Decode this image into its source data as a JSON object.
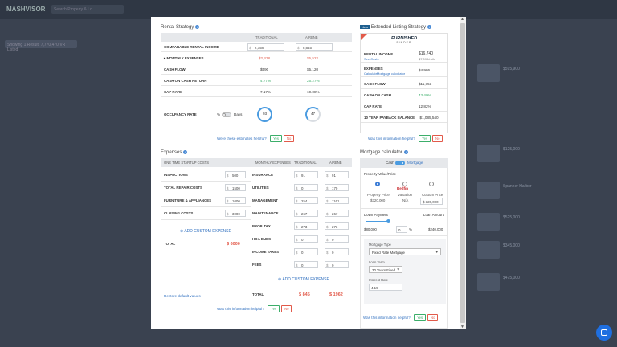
{
  "background": {
    "logo": "MASHVISOR",
    "search_placeholder": "Search Property & Lo",
    "chip": "Showing 1 Result, 7,770,470 VR Listed",
    "listing_title_1": "$595,900",
    "listing_title_2": "$125,000",
    "listing_title_3": "$525,000",
    "listing_title_4": "$345,000",
    "listing_title_5": "$475,000",
    "listing_sub": "Spanner Harbor"
  },
  "rental_strategy": {
    "title": "Rental Strategy",
    "col_traditional": "TRADITIONAL",
    "col_airbnb": "AIRBNB",
    "comparable_label": "COMPARABLE RENTAL INCOME",
    "comparable_trad": "2,758",
    "comparable_air": "8,645",
    "currency": "$",
    "monthly_expenses_label": "MONTHLY EXPENSES",
    "monthly_expenses_trad": "$2,438",
    "monthly_expenses_air": "$5,522",
    "cash_flow_label": "CASH FLOW",
    "cash_flow_trad": "$590",
    "cash_flow_air": "$5,120",
    "coc_label": "CASH ON CASH RETURN",
    "coc_trad": "4.77%",
    "coc_air": "25.27%",
    "cap_label": "CAP RATE",
    "cap_trad": "7.17%",
    "cap_air": "10.08%",
    "occupancy_label": "OCCUPANCY RATE",
    "occupancy_pct": "%",
    "occupancy_days": "Days",
    "occupancy_trad": "93",
    "occupancy_air": "47",
    "helpful": "Were these estimates helpful?",
    "yes": "Yes",
    "no": "No"
  },
  "extended": {
    "badge": "New",
    "title": "Extended Listing Strategy",
    "brand_line1": "FURNISHED",
    "brand_line2": "FINDER",
    "rental_income_label": "RENTAL INCOME",
    "rental_income_link": "See Costs",
    "rental_income_val": "$16,740",
    "rental_income_sub": "$7,090/mth",
    "expenses_label": "EXPENSES",
    "expenses_link1": "Calculate",
    "expenses_link2": "Mortgage calculator",
    "expenses_val": "$4,986",
    "cash_flow_label": "CASH FLOW",
    "cash_flow_val": "$11,753",
    "coc_label": "CASH ON CASH",
    "coc_val": "43.40%",
    "cap_label": "CAP RATE",
    "cap_val": "12.82%",
    "payback_label": "10 YEAR PAYBACK BALANCE",
    "payback_val": "-$1,085,540",
    "helpful": "Was this information helpful?",
    "yes": "Yes",
    "no": "No"
  },
  "expenses": {
    "title": "Expenses",
    "one_time_header": "ONE TIME STARTUP COSTS",
    "monthly_header": "MONTHLY EXPENSES",
    "col_traditional": "TRADITIONAL",
    "col_airbnb": "AIRBNB",
    "currency": "$",
    "one_time": [
      {
        "label": "INSPECTIONS",
        "value": "500"
      },
      {
        "label": "TOTAL REPAIR COSTS",
        "value": "1500"
      },
      {
        "label": "FURNITURE & APPLIANCES",
        "value": "1000"
      },
      {
        "label": "CLOSING COSTS",
        "value": "3000"
      }
    ],
    "add_custom_left": "ADD CUSTOM EXPENSE",
    "total_label": "TOTAL",
    "total_value": "$ 6000",
    "monthly": [
      {
        "label": "INSURANCE",
        "trad": "91",
        "air": "91"
      },
      {
        "label": "UTILITIES",
        "trad": "0",
        "air": "170"
      },
      {
        "label": "MANAGEMENT",
        "trad": "254",
        "air": "1161"
      },
      {
        "label": "MAINTENANCE",
        "trad": "267",
        "air": "267"
      },
      {
        "label": "PROP. TAX",
        "trad": "273",
        "air": "273"
      },
      {
        "label": "HOA DUES",
        "trad": "0",
        "air": "0"
      },
      {
        "label": "INCOME TAXES",
        "trad": "0",
        "air": "0"
      },
      {
        "label": "FEES",
        "trad": "0",
        "air": "0"
      }
    ],
    "add_custom_right": "ADD CUSTOM EXPENSE",
    "monthly_total_label": "TOTAL",
    "monthly_total_trad": "$ 845",
    "monthly_total_air": "$ 1962",
    "restore": "Restore default values",
    "helpful": "Was this information helpful?",
    "yes": "Yes",
    "no": "No"
  },
  "mortgage": {
    "title": "Mortgage calculator",
    "cash": "Cash",
    "mortgage": "Mortgage",
    "property_value_label": "Property Value/Price",
    "opt_property_price": "Property Price",
    "opt_property_price_val": "$320,000",
    "opt_redfin": "Redfin",
    "opt_valuation": "Valuation",
    "opt_valuation_val": "N/A",
    "opt_custom": "Custom Price",
    "opt_custom_val": "$ 320,000",
    "down_payment_label": "Down Payment",
    "loan_amount_label": "Loan Amount",
    "down_payment_val": "$80,000",
    "down_payment_pct": "0",
    "pct_sign": "%",
    "loan_amount_val": "$240,000",
    "mortgage_type_label": "Mortgage Type",
    "mortgage_type_val": "Fixed Rate Mortgage",
    "loan_term_label": "Loan Term",
    "loan_term_val": "30 Years Fixed",
    "interest_label": "Interest Rate",
    "interest_val": "4.19",
    "helpful": "Was this information helpful?",
    "yes": "Yes",
    "no": "No"
  }
}
